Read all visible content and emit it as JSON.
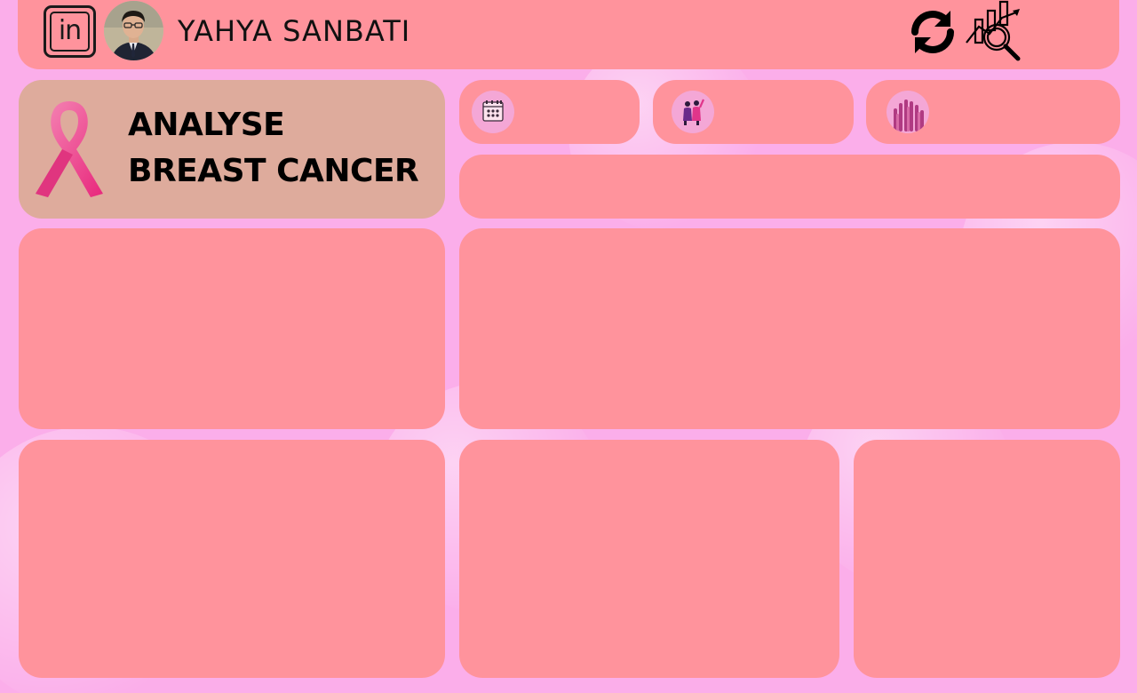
{
  "header": {
    "user_name": "YAHYA SANBATI",
    "linkedin_icon_text": "in",
    "icons": [
      "linkedin-icon",
      "avatar",
      "refresh-icon",
      "analysis-icon"
    ]
  },
  "title_card": {
    "line1": "ANALYSE",
    "line2": "BREAST CANCER",
    "icon": "pink-ribbon-icon"
  },
  "kpis": [
    {
      "icon": "calendar-icon"
    },
    {
      "icon": "women-group-icon"
    },
    {
      "icon": "raised-hands-icon"
    }
  ],
  "colors": {
    "background": "#fbaeea",
    "card": "#ff939c",
    "title_card": "#deab9c",
    "ribbon": "#ec3f8a",
    "icon_circle": "#f4a7d6"
  }
}
